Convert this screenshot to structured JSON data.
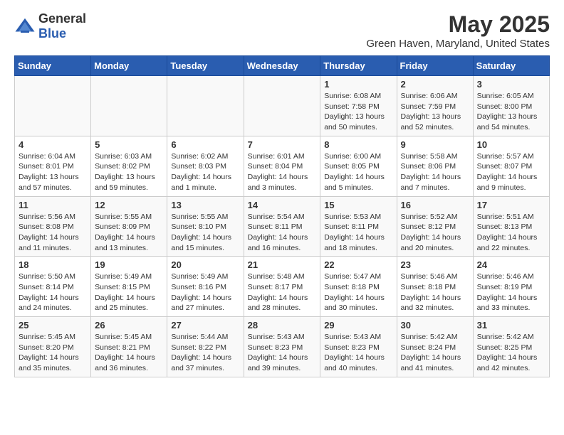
{
  "header": {
    "logo_general": "General",
    "logo_blue": "Blue",
    "month_title": "May 2025",
    "location": "Green Haven, Maryland, United States"
  },
  "weekdays": [
    "Sunday",
    "Monday",
    "Tuesday",
    "Wednesday",
    "Thursday",
    "Friday",
    "Saturday"
  ],
  "weeks": [
    [
      {
        "day": "",
        "info": ""
      },
      {
        "day": "",
        "info": ""
      },
      {
        "day": "",
        "info": ""
      },
      {
        "day": "",
        "info": ""
      },
      {
        "day": "1",
        "info": "Sunrise: 6:08 AM\nSunset: 7:58 PM\nDaylight: 13 hours\nand 50 minutes."
      },
      {
        "day": "2",
        "info": "Sunrise: 6:06 AM\nSunset: 7:59 PM\nDaylight: 13 hours\nand 52 minutes."
      },
      {
        "day": "3",
        "info": "Sunrise: 6:05 AM\nSunset: 8:00 PM\nDaylight: 13 hours\nand 54 minutes."
      }
    ],
    [
      {
        "day": "4",
        "info": "Sunrise: 6:04 AM\nSunset: 8:01 PM\nDaylight: 13 hours\nand 57 minutes."
      },
      {
        "day": "5",
        "info": "Sunrise: 6:03 AM\nSunset: 8:02 PM\nDaylight: 13 hours\nand 59 minutes."
      },
      {
        "day": "6",
        "info": "Sunrise: 6:02 AM\nSunset: 8:03 PM\nDaylight: 14 hours\nand 1 minute."
      },
      {
        "day": "7",
        "info": "Sunrise: 6:01 AM\nSunset: 8:04 PM\nDaylight: 14 hours\nand 3 minutes."
      },
      {
        "day": "8",
        "info": "Sunrise: 6:00 AM\nSunset: 8:05 PM\nDaylight: 14 hours\nand 5 minutes."
      },
      {
        "day": "9",
        "info": "Sunrise: 5:58 AM\nSunset: 8:06 PM\nDaylight: 14 hours\nand 7 minutes."
      },
      {
        "day": "10",
        "info": "Sunrise: 5:57 AM\nSunset: 8:07 PM\nDaylight: 14 hours\nand 9 minutes."
      }
    ],
    [
      {
        "day": "11",
        "info": "Sunrise: 5:56 AM\nSunset: 8:08 PM\nDaylight: 14 hours\nand 11 minutes."
      },
      {
        "day": "12",
        "info": "Sunrise: 5:55 AM\nSunset: 8:09 PM\nDaylight: 14 hours\nand 13 minutes."
      },
      {
        "day": "13",
        "info": "Sunrise: 5:55 AM\nSunset: 8:10 PM\nDaylight: 14 hours\nand 15 minutes."
      },
      {
        "day": "14",
        "info": "Sunrise: 5:54 AM\nSunset: 8:11 PM\nDaylight: 14 hours\nand 16 minutes."
      },
      {
        "day": "15",
        "info": "Sunrise: 5:53 AM\nSunset: 8:11 PM\nDaylight: 14 hours\nand 18 minutes."
      },
      {
        "day": "16",
        "info": "Sunrise: 5:52 AM\nSunset: 8:12 PM\nDaylight: 14 hours\nand 20 minutes."
      },
      {
        "day": "17",
        "info": "Sunrise: 5:51 AM\nSunset: 8:13 PM\nDaylight: 14 hours\nand 22 minutes."
      }
    ],
    [
      {
        "day": "18",
        "info": "Sunrise: 5:50 AM\nSunset: 8:14 PM\nDaylight: 14 hours\nand 24 minutes."
      },
      {
        "day": "19",
        "info": "Sunrise: 5:49 AM\nSunset: 8:15 PM\nDaylight: 14 hours\nand 25 minutes."
      },
      {
        "day": "20",
        "info": "Sunrise: 5:49 AM\nSunset: 8:16 PM\nDaylight: 14 hours\nand 27 minutes."
      },
      {
        "day": "21",
        "info": "Sunrise: 5:48 AM\nSunset: 8:17 PM\nDaylight: 14 hours\nand 28 minutes."
      },
      {
        "day": "22",
        "info": "Sunrise: 5:47 AM\nSunset: 8:18 PM\nDaylight: 14 hours\nand 30 minutes."
      },
      {
        "day": "23",
        "info": "Sunrise: 5:46 AM\nSunset: 8:18 PM\nDaylight: 14 hours\nand 32 minutes."
      },
      {
        "day": "24",
        "info": "Sunrise: 5:46 AM\nSunset: 8:19 PM\nDaylight: 14 hours\nand 33 minutes."
      }
    ],
    [
      {
        "day": "25",
        "info": "Sunrise: 5:45 AM\nSunset: 8:20 PM\nDaylight: 14 hours\nand 35 minutes."
      },
      {
        "day": "26",
        "info": "Sunrise: 5:45 AM\nSunset: 8:21 PM\nDaylight: 14 hours\nand 36 minutes."
      },
      {
        "day": "27",
        "info": "Sunrise: 5:44 AM\nSunset: 8:22 PM\nDaylight: 14 hours\nand 37 minutes."
      },
      {
        "day": "28",
        "info": "Sunrise: 5:43 AM\nSunset: 8:23 PM\nDaylight: 14 hours\nand 39 minutes."
      },
      {
        "day": "29",
        "info": "Sunrise: 5:43 AM\nSunset: 8:23 PM\nDaylight: 14 hours\nand 40 minutes."
      },
      {
        "day": "30",
        "info": "Sunrise: 5:42 AM\nSunset: 8:24 PM\nDaylight: 14 hours\nand 41 minutes."
      },
      {
        "day": "31",
        "info": "Sunrise: 5:42 AM\nSunset: 8:25 PM\nDaylight: 14 hours\nand 42 minutes."
      }
    ]
  ]
}
